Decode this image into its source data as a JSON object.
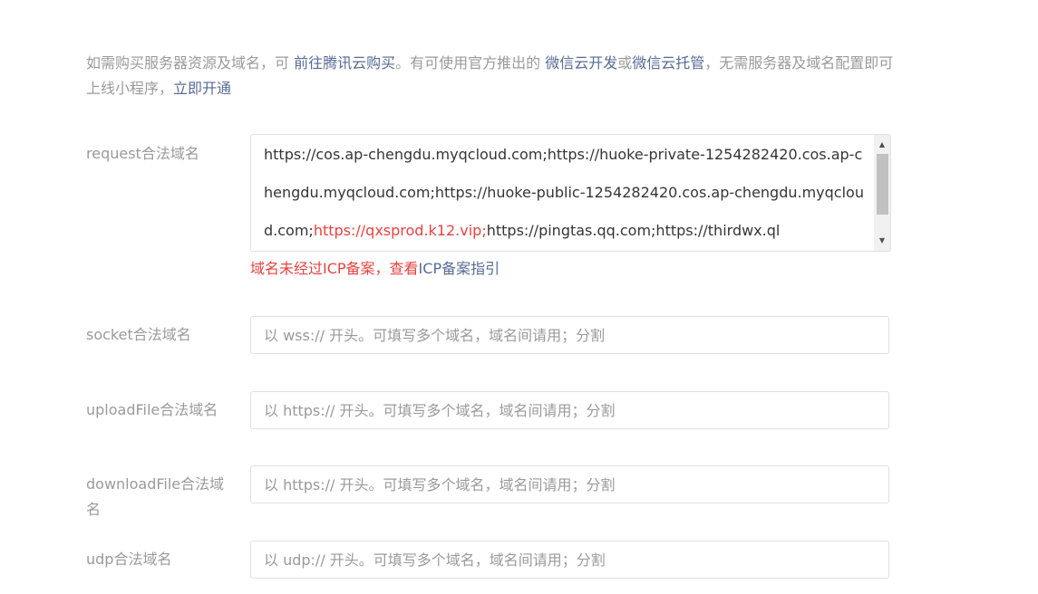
{
  "notice": {
    "text_1": "如需购买服务器资源及域名，可 ",
    "link_buy": "前往腾讯云购买",
    "text_2": "。有可使用官方推出的 ",
    "link_wxcloud": "微信云开发",
    "text_or": "或",
    "link_hosting": "微信云托管",
    "text_3": "，无需服务器及域名配置即可上线小程序，",
    "link_open": "立即开通"
  },
  "request": {
    "label": "request合法域名",
    "value_part1": "https://cos.ap-chengdu.myqcloud.com;https://huoke-private-1254282420.cos.ap-chengdu.myqcloud.com;https://huoke-public-1254282420.cos.ap-chengdu.myqcloud.com;",
    "value_error": "https://qxsprod.k12.vip;",
    "value_part2": "https://pingtas.qq.com;https://thirdwx.ql",
    "error_text": "域名未经过ICP备案，查看",
    "error_link": "ICP备案指引"
  },
  "socket": {
    "label": "socket合法域名",
    "placeholder": "以 wss:// 开头。可填写多个域名，域名间请用；分割"
  },
  "uploadFile": {
    "label": "uploadFile合法域名",
    "placeholder": "以 https:// 开头。可填写多个域名，域名间请用；分割"
  },
  "downloadFile": {
    "label": "downloadFile合法域名",
    "placeholder": "以 https:// 开头。可填写多个域名，域名间请用；分割"
  },
  "udp": {
    "label": "udp合法域名",
    "placeholder": "以 udp:// 开头。可填写多个域名，域名间请用；分割"
  },
  "icons": {
    "scroll_up": "triangle-up-icon",
    "scroll_down": "triangle-down-icon"
  },
  "colors": {
    "link": "#576b95",
    "error": "#e64340",
    "label": "#9a9a9a",
    "text": "#353535",
    "border": "#e0e0e0"
  }
}
